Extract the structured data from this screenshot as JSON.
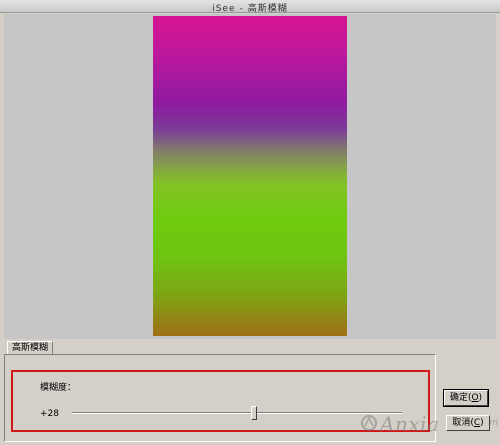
{
  "window": {
    "title_app": "iSee",
    "title_separator": "-",
    "title_dialog": "高斯模糊"
  },
  "preview": {
    "description_colors": [
      "#d9138e",
      "#8e1aa0",
      "#70cc10",
      "#a46714"
    ]
  },
  "tabs": [
    {
      "label": "高斯模糊",
      "selected": true
    }
  ],
  "settings": {
    "blur_label": "模糊度：",
    "blur_value": "+28",
    "slider_value": 28,
    "slider_range": [
      0,
      50
    ]
  },
  "buttons": {
    "ok_label": "确定",
    "ok_shortcut": "O",
    "cancel_label": "取消",
    "cancel_shortcut": "C"
  },
  "watermark": {
    "text": "Anxia",
    "suffix": ".com"
  },
  "colors": {
    "highlight_border": "#d01818",
    "window_bg": "#d4d0c8"
  }
}
